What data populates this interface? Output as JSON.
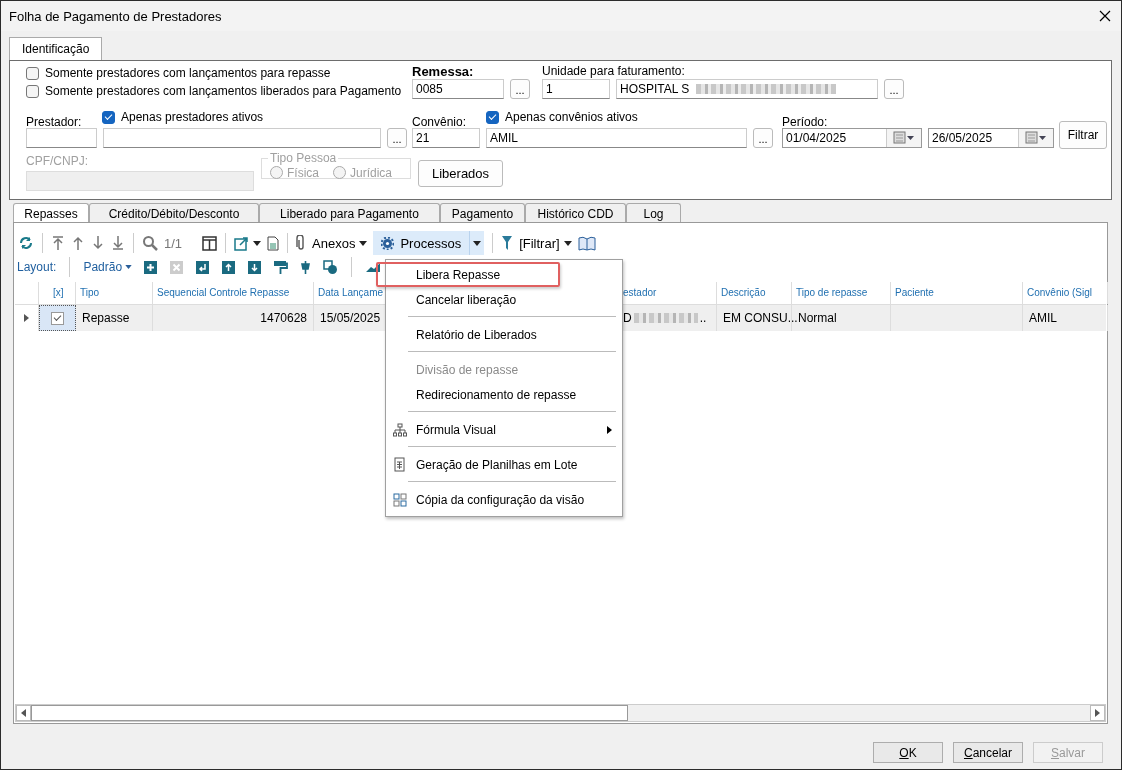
{
  "window": {
    "title": "Folha de Pagamento de Prestadores"
  },
  "top_tabs": [
    {
      "label": "Identificação",
      "selected": true
    }
  ],
  "filters": [
    {
      "label": "Somente prestadores com lançamentos para repasse",
      "checked": false
    },
    {
      "label": "Somente prestadores com lançamentos liberados para Pagamento",
      "checked": false
    }
  ],
  "remessa": {
    "label": "Remessa:",
    "value": "0085",
    "button": "..."
  },
  "unidade": {
    "label": "Unidade para faturamento:",
    "code": "1",
    "name": "HOSPITAL S",
    "button": "..."
  },
  "prestador": {
    "label": "Prestador:",
    "active_only": {
      "label": "Apenas prestadores ativos",
      "checked": true
    },
    "button": "..."
  },
  "convenio": {
    "label": "Convênio:",
    "active_only": {
      "label": "Apenas convênios ativos",
      "checked": true
    },
    "code": "21",
    "name": "AMIL",
    "button": "..."
  },
  "periodo": {
    "label": "Período:",
    "start": "01/04/2025",
    "end": "26/05/2025"
  },
  "filter_button": "Filtrar",
  "cpf": {
    "label": "CPF/CNPJ:",
    "disabled": true
  },
  "tipo_pessoa": {
    "legend": "Tipo Pessoa",
    "disabled": true,
    "options": [
      {
        "label": "Física",
        "selected": false
      },
      {
        "label": "Jurídica",
        "selected": false
      }
    ]
  },
  "liberados_button": "Liberados",
  "tabs": [
    {
      "label": "Repasses",
      "selected": true
    },
    {
      "label": "Crédito/Débito/Desconto",
      "selected": false
    },
    {
      "label": "Liberado para Pagamento",
      "selected": false
    },
    {
      "label": "Pagamento",
      "selected": false
    },
    {
      "label": "Histórico CDD",
      "selected": false
    },
    {
      "label": "Log",
      "selected": false
    }
  ],
  "toolbar": {
    "page": "1/1",
    "anexos": "Anexos",
    "processos": {
      "label": "Processos",
      "open": true
    },
    "filter": "[Filtrar]"
  },
  "layout_bar": {
    "label": "Layout:",
    "value": "Padrão"
  },
  "table": {
    "columns": [
      "[x]",
      "Tipo",
      "Sequencial Controle Repasse",
      "Data Lançame",
      "estador",
      "Descrição",
      "Tipo de repasse",
      "Paciente",
      "Convênio (Sigl"
    ],
    "rows": [
      {
        "selected": true,
        "checked": true,
        "cells": {
          "tipo": "Repasse",
          "sequencial": "1470628",
          "data": "15/05/2025",
          "prestador": "D",
          "prestador_end": "..",
          "descricao": "EM CONSU...",
          "tipo_repasse": "Normal",
          "convenio": "AMIL"
        }
      }
    ]
  },
  "menu": {
    "items": [
      {
        "kind": "item",
        "label": "Libera Repasse",
        "selected": true,
        "disabled": false,
        "submenu": false
      },
      {
        "kind": "item",
        "label": "Cancelar liberação",
        "selected": false,
        "disabled": false,
        "submenu": false
      },
      {
        "kind": "separator"
      },
      {
        "kind": "item",
        "label": "Relatório de Liberados",
        "selected": false,
        "disabled": false,
        "submenu": false
      },
      {
        "kind": "separator"
      },
      {
        "kind": "item",
        "label": "Divisão de repasse",
        "selected": false,
        "disabled": true,
        "submenu": false
      },
      {
        "kind": "item",
        "label": "Redirecionamento de repasse",
        "selected": false,
        "disabled": false,
        "submenu": false
      },
      {
        "kind": "separator"
      },
      {
        "kind": "item",
        "label": "Fórmula Visual",
        "selected": false,
        "disabled": false,
        "submenu": true
      },
      {
        "kind": "separator"
      },
      {
        "kind": "item",
        "label": "Geração de Planilhas em Lote",
        "selected": false,
        "disabled": false,
        "submenu": false
      },
      {
        "kind": "separator"
      },
      {
        "kind": "item",
        "label": "Cópia da configuração da visão",
        "selected": false,
        "disabled": false,
        "submenu": false
      }
    ]
  },
  "buttons": [
    {
      "label": "OK",
      "disabled": false
    },
    {
      "label": "Cancelar",
      "disabled": false
    },
    {
      "label": "Salvar",
      "disabled": true
    }
  ]
}
